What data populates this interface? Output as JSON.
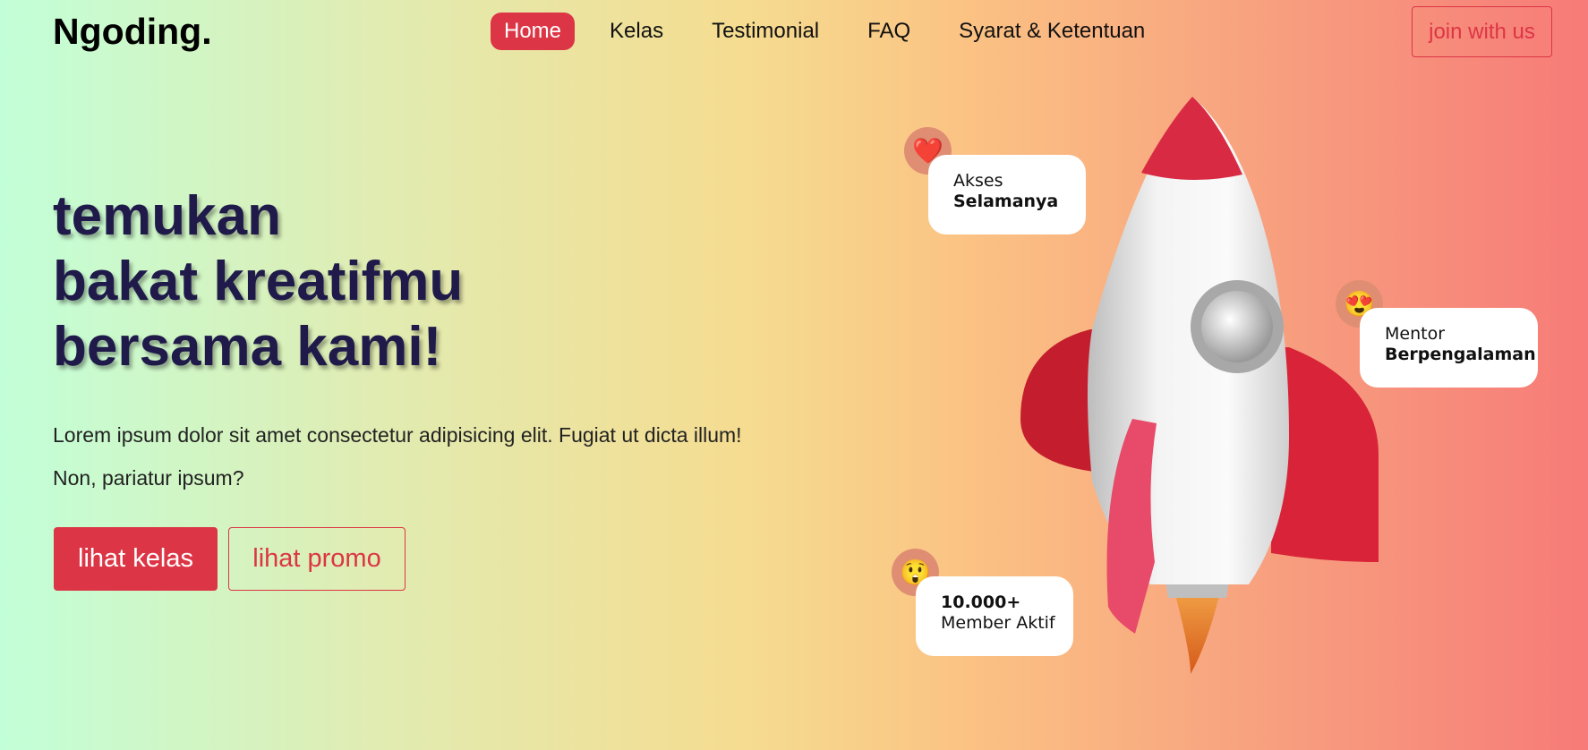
{
  "brand": "Ngoding.",
  "nav": {
    "items": [
      "Home",
      "Kelas",
      "Testimonial",
      "FAQ",
      "Syarat & Ketentuan"
    ],
    "active_index": 0,
    "join_label": "join with us"
  },
  "hero": {
    "title_lines": [
      "temukan",
      "bakat kreatifmu",
      "bersama kami!"
    ],
    "description": "Lorem ipsum dolor sit amet consectetur adipisicing elit. Fugiat ut dicta illum! Non, pariatur ipsum?",
    "primary_button": "lihat kelas",
    "secondary_button": "lihat promo"
  },
  "badges": [
    {
      "icon": "heart-icon",
      "glyph": "❤️",
      "line1": "Akses",
      "line2": "Selamanya"
    },
    {
      "icon": "heart-eyes-emoji-icon",
      "glyph": "😍",
      "line1": "Mentor",
      "line2": "Berpengalaman"
    },
    {
      "icon": "shocked-emoji-icon",
      "glyph": "😲",
      "line1": "10.000+",
      "line2": "Member Aktif"
    }
  ],
  "colors": {
    "accent": "#dc3545",
    "title": "#1f1a4a"
  }
}
